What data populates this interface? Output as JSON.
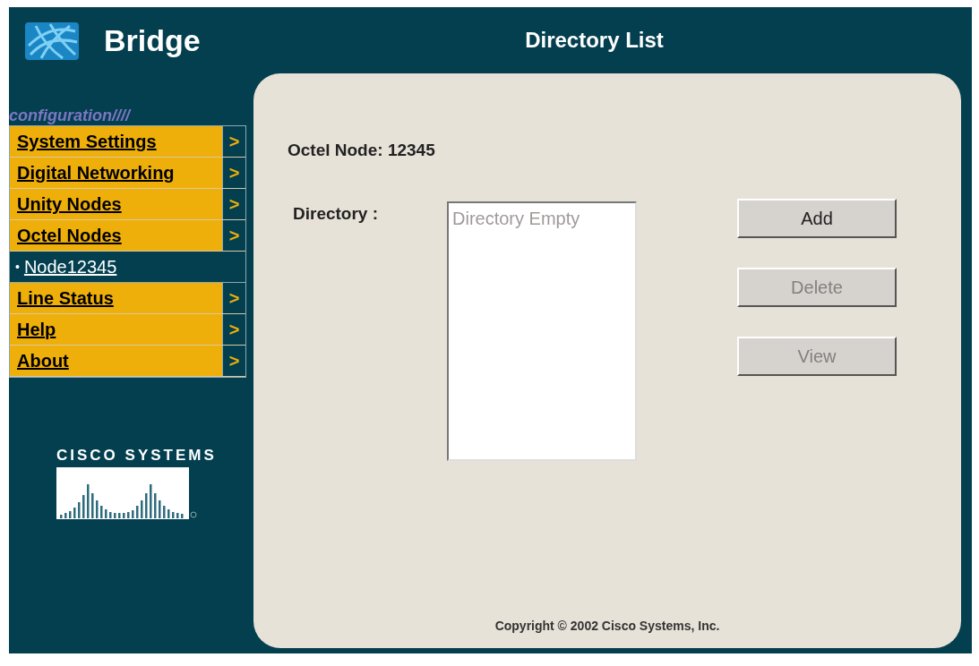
{
  "header": {
    "app_title": "Bridge",
    "page_title": "Directory List"
  },
  "sidebar": {
    "section_label": "configuration",
    "section_suffix": "////",
    "items": [
      {
        "kind": "menu",
        "label": "System Settings",
        "arrow": ">"
      },
      {
        "kind": "menu",
        "label": "Digital Networking",
        "arrow": ">"
      },
      {
        "kind": "menu",
        "label": "Unity Nodes",
        "arrow": ">"
      },
      {
        "kind": "menu",
        "label": "Octel Nodes",
        "arrow": ">"
      },
      {
        "kind": "subitem",
        "label": "Node12345",
        "bullet": "•"
      },
      {
        "kind": "menu",
        "label": "Line Status",
        "arrow": ">"
      },
      {
        "kind": "menu",
        "label": "Help",
        "arrow": ">"
      },
      {
        "kind": "menu",
        "label": "About",
        "arrow": ">"
      }
    ],
    "logo_text": "CISCO SYSTEMS"
  },
  "content": {
    "node_heading": "Octel Node: 12345",
    "directory_label": "Directory :",
    "directory_list": {
      "placeholder": "Directory Empty"
    },
    "buttons": [
      {
        "label": "Add",
        "disabled": false
      },
      {
        "label": "Delete",
        "disabled": true
      },
      {
        "label": "View",
        "disabled": true
      }
    ],
    "copyright": "Copyright © 2002 Cisco Systems, Inc."
  }
}
